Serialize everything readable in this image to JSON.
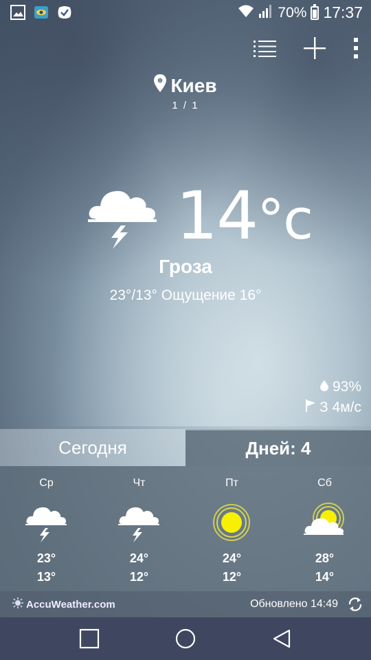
{
  "status_bar": {
    "wifi": "wifi-icon",
    "signal": "signal-icon",
    "battery_percent": "70%",
    "time": "17:37"
  },
  "location": {
    "city": "Киев",
    "page_indicator": "1 / 1"
  },
  "current": {
    "temperature": "14",
    "unit": "°c",
    "condition": "Гроза",
    "range_feels": "23°/13° Ощущение 16°",
    "humidity": "93%",
    "wind": "З 4м/с"
  },
  "tabs": {
    "today": "Сегодня",
    "days": "Дней: 4"
  },
  "forecast": [
    {
      "day": "Ср",
      "icon": "thunderstorm-icon",
      "high": "23°",
      "low": "13°"
    },
    {
      "day": "Чт",
      "icon": "thunderstorm-icon",
      "high": "24°",
      "low": "12°"
    },
    {
      "day": "Пт",
      "icon": "sun-icon",
      "high": "24°",
      "low": "12°"
    },
    {
      "day": "Сб",
      "icon": "partly-cloudy-icon",
      "high": "28°",
      "low": "14°"
    }
  ],
  "footer": {
    "provider": "AccuWeather.com",
    "updated": "Обновлено 14:49"
  }
}
